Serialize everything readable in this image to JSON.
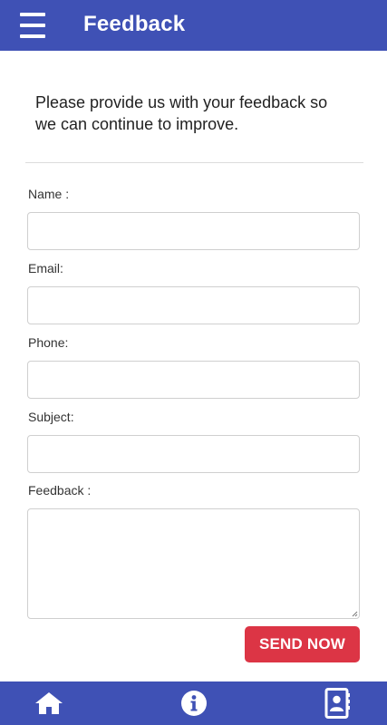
{
  "header": {
    "menu_icon": "hamburger-menu-icon",
    "title": "Feedback"
  },
  "intro": {
    "text": "Please provide us with your feedback so we can continue to improve."
  },
  "form": {
    "name_label": "Name :",
    "name_value": "",
    "email_label": "Email:",
    "email_value": "",
    "phone_label": "Phone:",
    "phone_value": "",
    "subject_label": "Subject:",
    "subject_value": "",
    "feedback_label": "Feedback :",
    "feedback_value": "",
    "send_label": "SEND NOW"
  },
  "bottom_nav": {
    "items": [
      {
        "icon": "home-icon"
      },
      {
        "icon": "info-icon"
      },
      {
        "icon": "contact-book-icon"
      }
    ]
  },
  "colors": {
    "primary": "#3f51b5",
    "send_button": "#dc3545",
    "background": "#ffffff"
  }
}
